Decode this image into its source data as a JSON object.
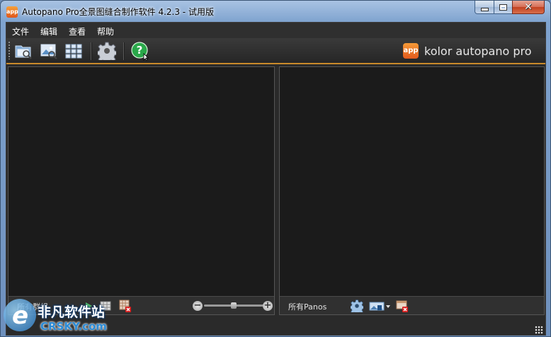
{
  "window": {
    "title": "Autopano Pro全景图缝合制作软件  4.2.3 - 试用版",
    "app_icon_text": "app",
    "controls": {
      "minimize": "minimize-icon",
      "maximize": "maximize-icon",
      "close": "close-icon"
    }
  },
  "menu": {
    "items": [
      {
        "label": "文件"
      },
      {
        "label": "编辑"
      },
      {
        "label": "查看"
      },
      {
        "label": "帮助"
      }
    ]
  },
  "toolbar": {
    "buttons": [
      {
        "icon": "open-folder-icon"
      },
      {
        "icon": "detect-images-icon"
      },
      {
        "icon": "grid-group-icon"
      },
      {
        "icon": "settings-gear-icon"
      },
      {
        "icon": "help-icon"
      }
    ],
    "brand": {
      "logo_text": "app",
      "name": "kolor autopano pro"
    },
    "accent_color": "#c98a2a"
  },
  "left_panel": {
    "footer_label": "所有群组",
    "zoom_level": 0.5
  },
  "right_panel": {
    "footer_label": "所有Panos"
  },
  "watermark": {
    "cn_text": "非凡软件站",
    "en_text": "CRSKY.com"
  }
}
